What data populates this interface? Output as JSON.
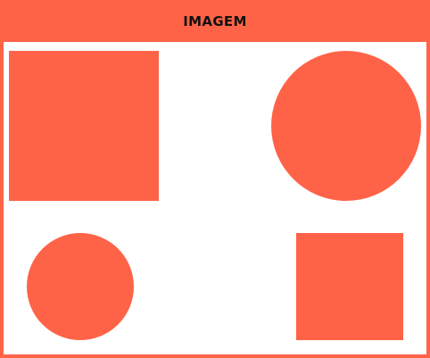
{
  "header": {
    "title": "IMAGEM"
  },
  "colors": {
    "accent": "#ff6347",
    "background": "#ffffff",
    "title_text": "#111111"
  },
  "shapes": [
    {
      "kind": "square",
      "color": "#ff6347"
    },
    {
      "kind": "circle",
      "color": "#ff6347"
    },
    {
      "kind": "circle",
      "color": "#ff6347"
    },
    {
      "kind": "square",
      "color": "#ff6347"
    }
  ]
}
